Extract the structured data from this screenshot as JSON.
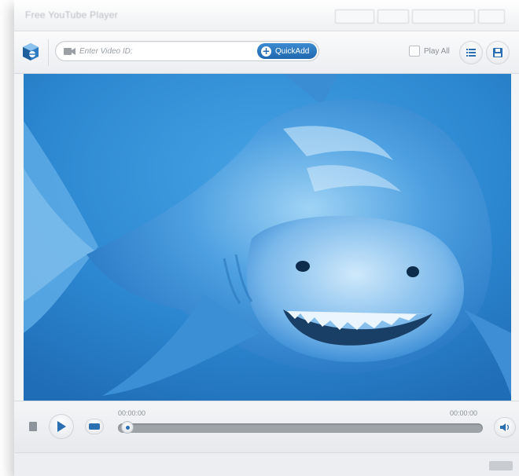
{
  "window": {
    "title": "Free YouTube Player"
  },
  "toolbar": {
    "logo_icon": "app-logo-icon",
    "search_placeholder": "Enter Video ID:",
    "search_value": "",
    "quickadd_label": "QuickAdd",
    "playall_label": "Play All",
    "playall_checked": false,
    "list_icon": "list-icon",
    "save_icon": "save-icon"
  },
  "video": {
    "subject": "great white shark underwater"
  },
  "controls": {
    "time_current": "00:00:00",
    "time_total": "00:00:00",
    "progress": 0.0,
    "stop_icon": "stop-icon",
    "play_icon": "play-icon",
    "hd_icon": "hd-icon",
    "volume_icon": "volume-icon"
  },
  "colors": {
    "accent": "#1f68b0",
    "water": "#2b86cf"
  }
}
